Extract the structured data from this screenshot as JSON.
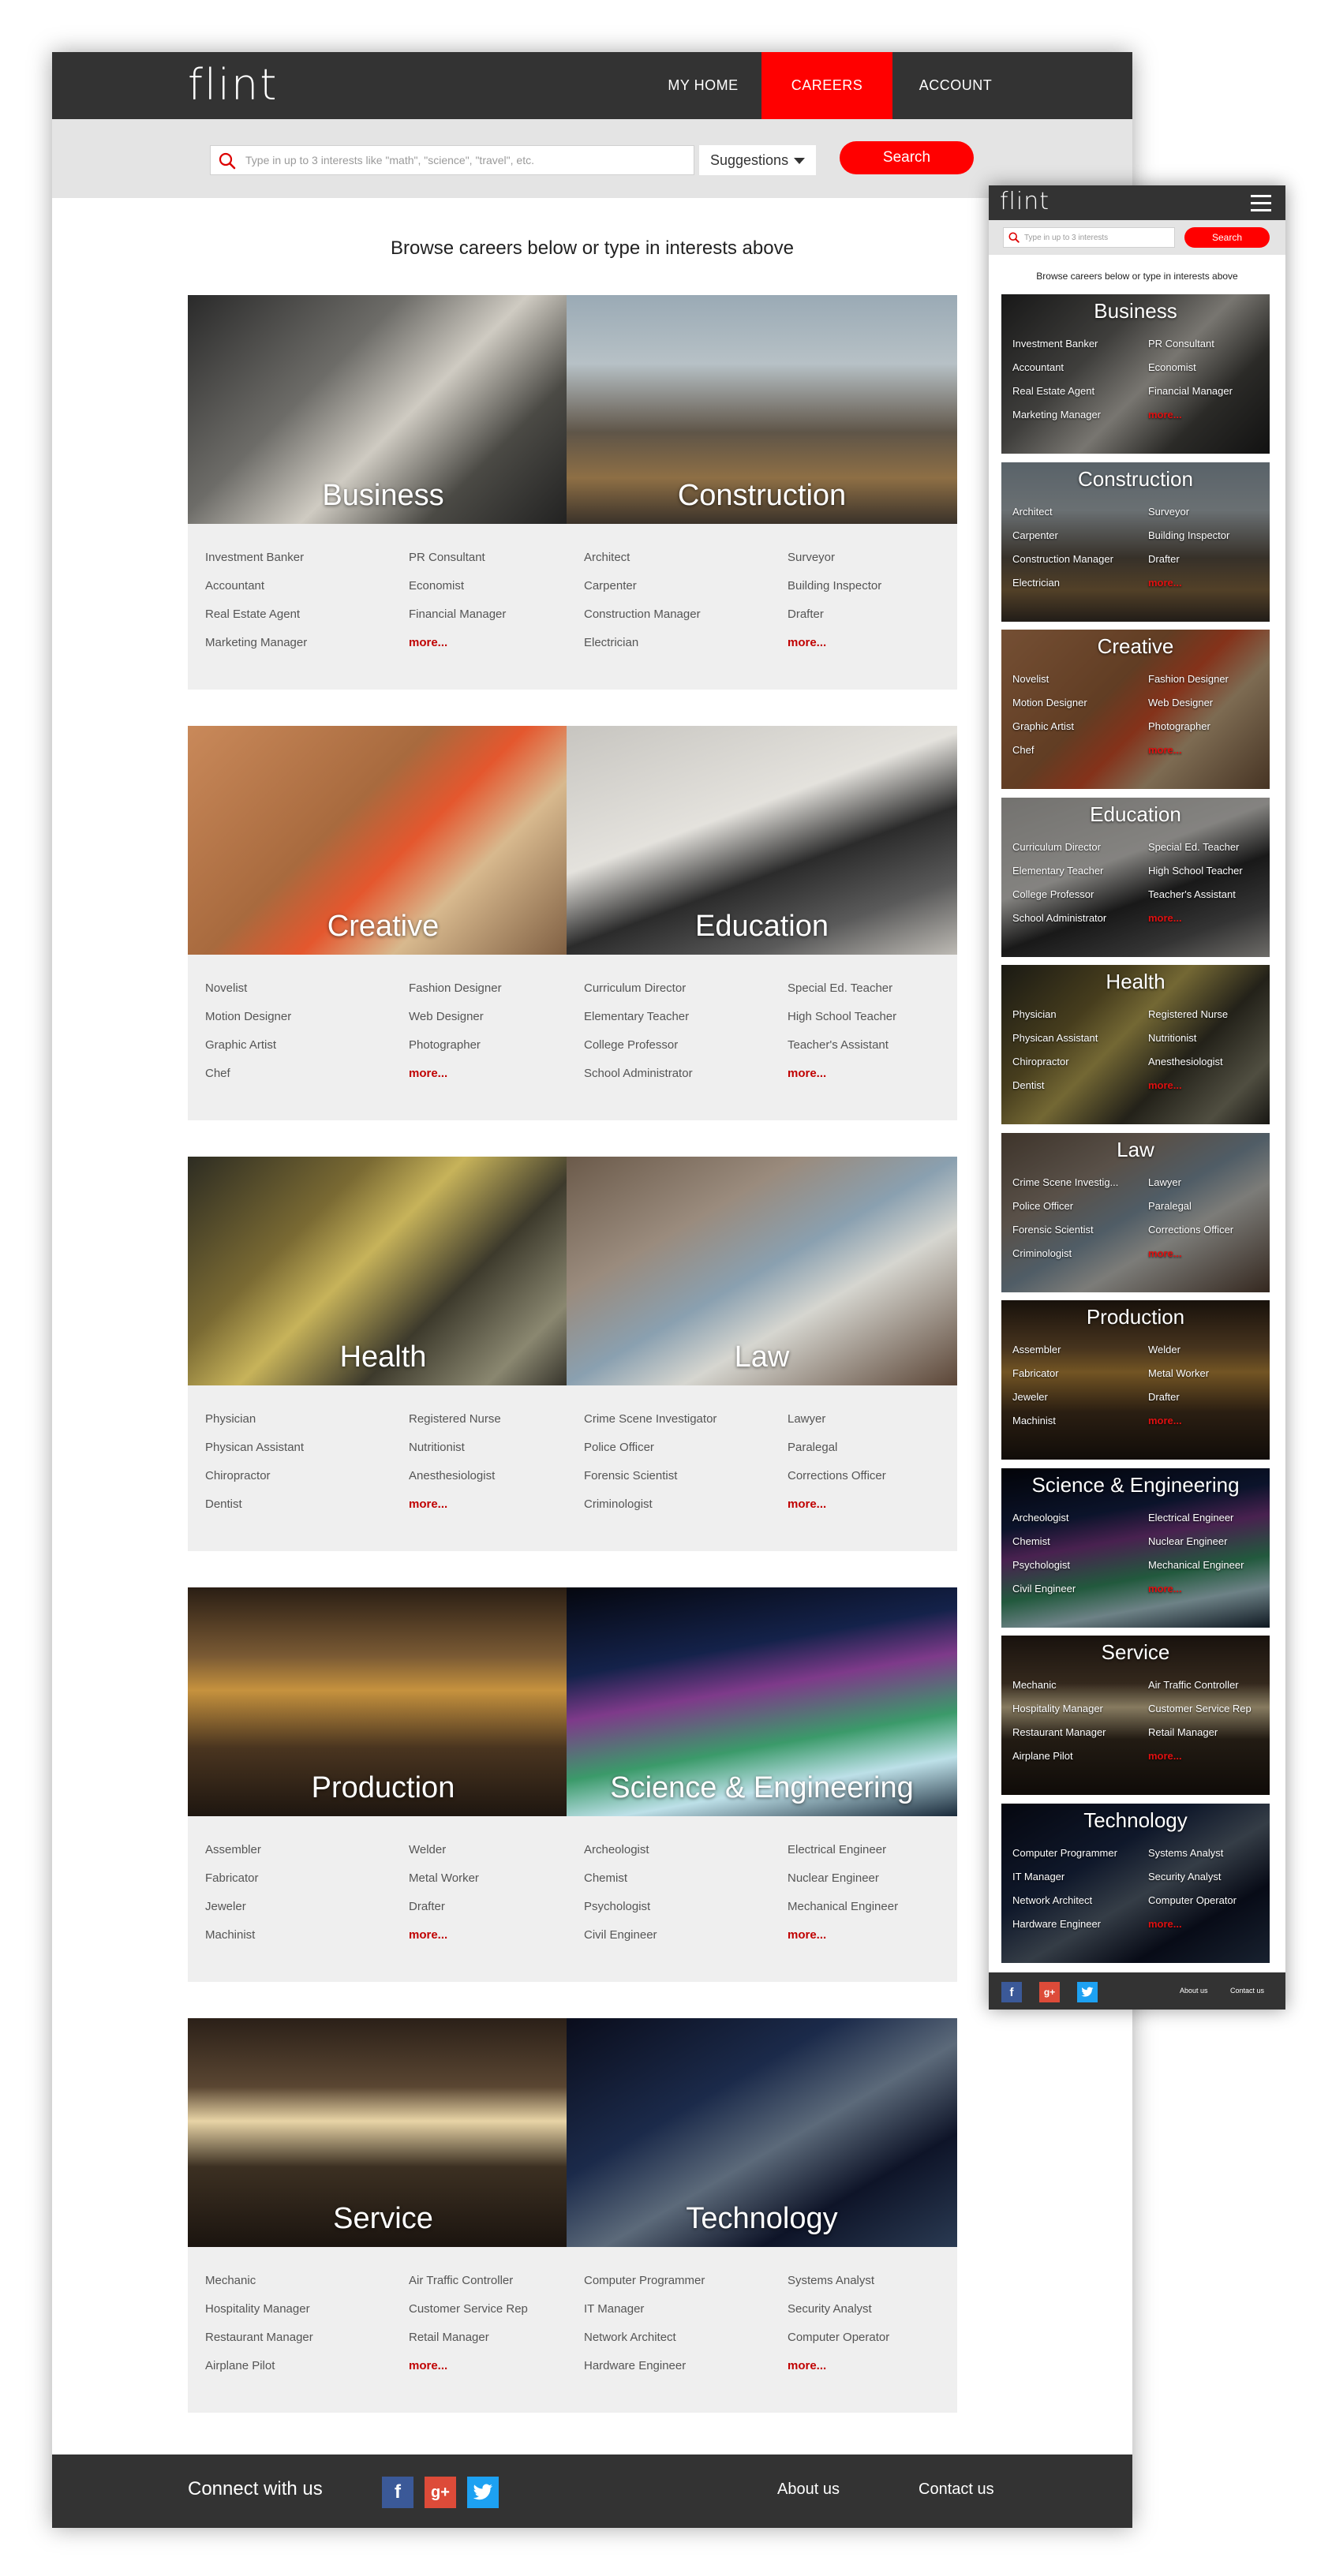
{
  "brand": {
    "logo": "flint"
  },
  "nav": {
    "home": "MY HOME",
    "careers": "CAREERS",
    "account": "ACCOUNT"
  },
  "search": {
    "placeholder": "Type in up to 3 interests like \"math\", \"science\", \"travel\", etc.",
    "suggestions_label": "Suggestions",
    "button": "Search"
  },
  "browse_text": "Browse careers below or type in interests above",
  "more_label": "more...",
  "colors": {
    "accent": "#ff0000",
    "header": "#333333",
    "card_bg": "#efefef",
    "more": "#c00000"
  },
  "categories": [
    {
      "title": "Business",
      "left": [
        "Investment Banker",
        "Accountant",
        "Real Estate Agent",
        "Marketing Manager"
      ],
      "right": [
        "PR Consultant",
        "Economist",
        "Financial Manager"
      ]
    },
    {
      "title": "Construction",
      "left": [
        "Architect",
        "Carpenter",
        "Construction Manager",
        "Electrician"
      ],
      "right": [
        "Surveyor",
        "Building Inspector",
        "Drafter"
      ]
    },
    {
      "title": "Creative",
      "left": [
        "Novelist",
        "Motion Designer",
        "Graphic Artist",
        "Chef"
      ],
      "right": [
        "Fashion Designer",
        "Web Designer",
        "Photographer"
      ]
    },
    {
      "title": "Education",
      "left": [
        "Curriculum Director",
        "Elementary Teacher",
        "College Professor",
        "School Administrator"
      ],
      "right": [
        "Special Ed. Teacher",
        "High School Teacher",
        "Teacher's Assistant"
      ]
    },
    {
      "title": "Health",
      "left": [
        "Physician",
        "Physican Assistant",
        "Chiropractor",
        "Dentist"
      ],
      "right": [
        "Registered Nurse",
        "Nutritionist",
        "Anesthesiologist"
      ]
    },
    {
      "title": "Law",
      "left": [
        "Crime Scene Investigator",
        "Police Officer",
        "Forensic Scientist",
        "Criminologist"
      ],
      "right": [
        "Lawyer",
        "Paralegal",
        "Corrections Officer"
      ]
    },
    {
      "title": "Production",
      "left": [
        "Assembler",
        "Fabricator",
        "Jeweler",
        "Machinist"
      ],
      "right": [
        "Welder",
        "Metal Worker",
        "Drafter"
      ]
    },
    {
      "title": "Science & Engineering",
      "left": [
        "Archeologist",
        "Chemist",
        "Psychologist",
        "Civil Engineer"
      ],
      "right": [
        "Electrical Engineer",
        "Nuclear Engineer",
        "Mechanical Engineer"
      ]
    },
    {
      "title": "Service",
      "left": [
        "Mechanic",
        "Hospitality Manager",
        "Restaurant Manager",
        "Airplane Pilot"
      ],
      "right": [
        "Air Traffic Controller",
        "Customer Service Rep",
        "Retail Manager"
      ]
    },
    {
      "title": "Technology",
      "left": [
        "Computer Programmer",
        "IT Manager",
        "Network Architect",
        "Hardware Engineer"
      ],
      "right": [
        "Systems Analyst",
        "Security Analyst",
        "Computer Operator"
      ]
    }
  ],
  "mobile": {
    "search_placeholder": "Type in up to 3 interests",
    "search_button": "Search",
    "mobile_crime_scene": "Crime Scene Investig..."
  },
  "footer": {
    "connect": "Connect with us",
    "about": "About us",
    "contact": "Contact us",
    "social": [
      "facebook-icon",
      "google-plus-icon",
      "twitter-icon"
    ]
  }
}
